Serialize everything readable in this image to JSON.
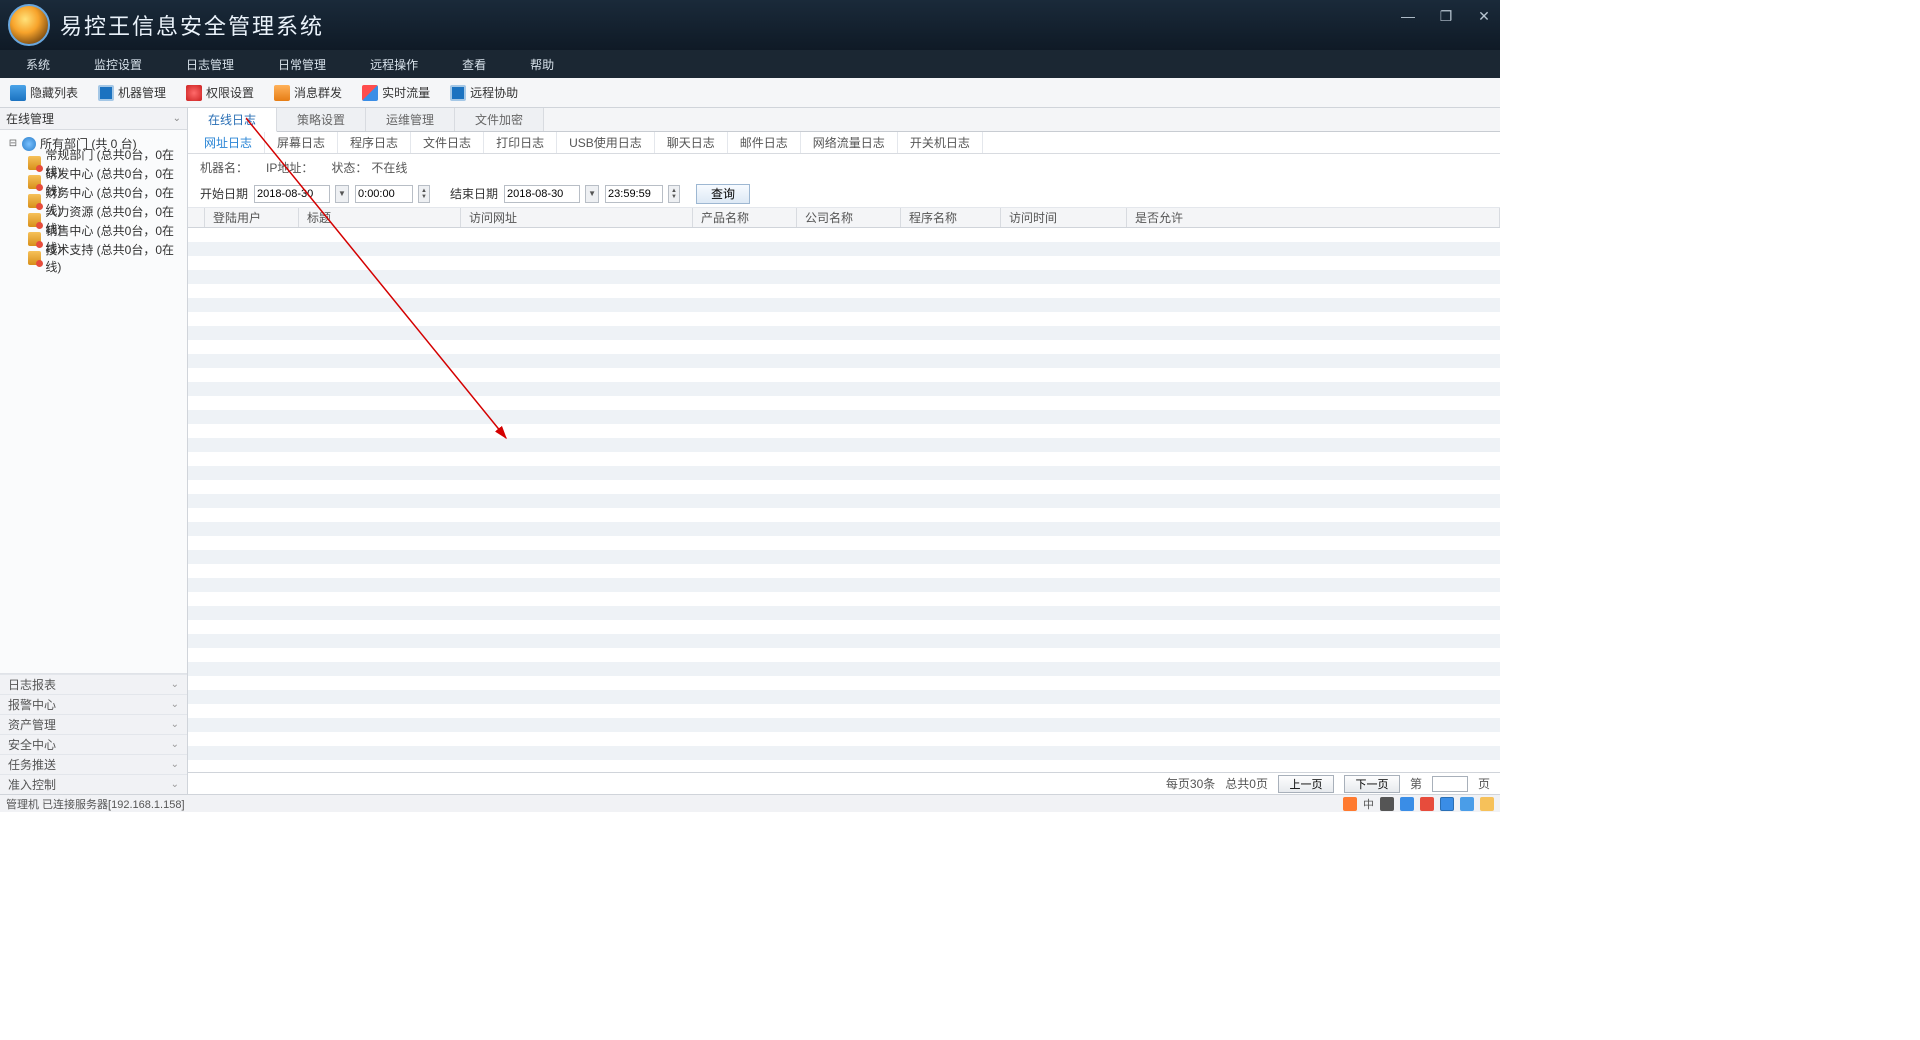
{
  "app": {
    "title": "易控王信息安全管理系统"
  },
  "menubar": [
    "系统",
    "监控设置",
    "日志管理",
    "日常管理",
    "远程操作",
    "查看",
    "帮助"
  ],
  "toolbar": [
    {
      "label": "隐藏列表",
      "icon": "ic-blue"
    },
    {
      "label": "机器管理",
      "icon": "ic-monitor"
    },
    {
      "label": "权限设置",
      "icon": "ic-red"
    },
    {
      "label": "消息群发",
      "icon": "ic-orange"
    },
    {
      "label": "实时流量",
      "icon": "ic-chart"
    },
    {
      "label": "远程协助",
      "icon": "ic-monitor"
    }
  ],
  "sidebar": {
    "combo": "在线管理",
    "root": "所有部门 (共 0 台)",
    "children": [
      "常规部门 (总共0台，0在线)",
      "研发中心 (总共0台，0在线)",
      "财务中心 (总共0台，0在线)",
      "人力资源 (总共0台，0在线)",
      "销售中心 (总共0台，0在线)",
      "技术支持 (总共0台，0在线)"
    ],
    "accordion": [
      "日志报表",
      "报警中心",
      "资产管理",
      "安全中心",
      "任务推送",
      "准入控制"
    ]
  },
  "tabs_primary": [
    "在线日志",
    "策略设置",
    "运维管理",
    "文件加密"
  ],
  "tabs_primary_active": 0,
  "tabs_secondary": [
    "网址日志",
    "屏幕日志",
    "程序日志",
    "文件日志",
    "打印日志",
    "USB使用日志",
    "聊天日志",
    "邮件日志",
    "网络流量日志",
    "开关机日志"
  ],
  "tabs_secondary_active": 0,
  "info": {
    "machine_label": "机器名：",
    "ip_label": "IP地址：",
    "status_label": "状态：",
    "status_value": "不在线"
  },
  "filter": {
    "start_label": "开始日期",
    "start_date": "2018-08-30",
    "start_time": "0:00:00",
    "end_label": "结束日期",
    "end_date": "2018-08-30",
    "end_time": "23:59:59",
    "query": "查询"
  },
  "grid": {
    "columns": [
      "",
      "登陆用户",
      "标题",
      "访问网址",
      "产品名称",
      "公司名称",
      "程序名称",
      "访问时间",
      "是否允许"
    ]
  },
  "pager": {
    "per_page": "每页30条",
    "total": "总共0页",
    "prev": "上一页",
    "next": "下一页",
    "page_prefix": "第",
    "page_suffix": "页",
    "page_input": ""
  },
  "status": {
    "left": "管理机  已连接服务器[192.168.1.158]",
    "ime": "中"
  }
}
